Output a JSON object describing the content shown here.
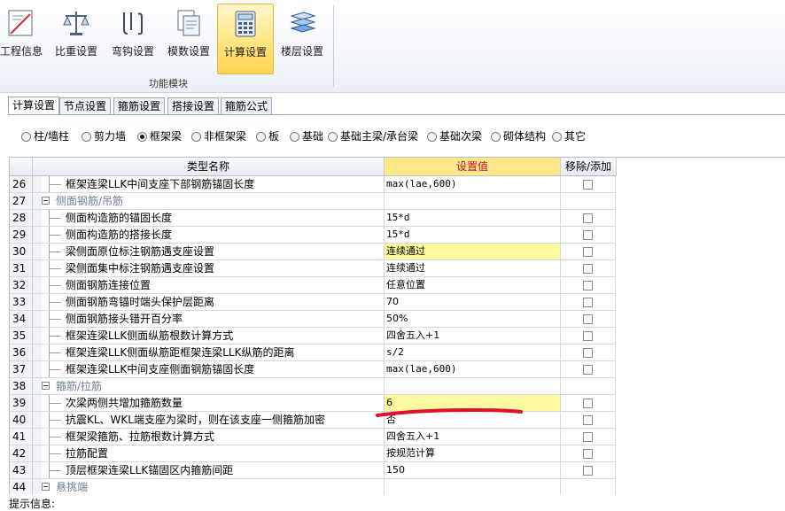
{
  "ribbon": {
    "buttons": [
      {
        "label": "工程信息",
        "icon": "project-info-icon"
      },
      {
        "label": "比重设置",
        "icon": "scale-icon"
      },
      {
        "label": "弯钩设置",
        "icon": "hook-icon"
      },
      {
        "label": "模数设置",
        "icon": "modulus-icon"
      },
      {
        "label": "计算设置",
        "icon": "calculator-icon",
        "active": true
      },
      {
        "label": "楼层设置",
        "icon": "floor-stack-icon"
      }
    ],
    "group_label": "功能模块"
  },
  "tabs": [
    "计算设置",
    "节点设置",
    "箍筋设置",
    "搭接设置",
    "箍筋公式"
  ],
  "radios": [
    {
      "label": "柱/墙柱",
      "checked": false
    },
    {
      "label": "剪力墙",
      "checked": false
    },
    {
      "label": "框架梁",
      "checked": true
    },
    {
      "label": "非框架梁",
      "checked": false
    },
    {
      "label": "板",
      "checked": false
    },
    {
      "label": "基础",
      "checked": false
    },
    {
      "label": "基础主梁/承台梁",
      "checked": false
    },
    {
      "label": "基础次梁",
      "checked": false
    },
    {
      "label": "砌体结构",
      "checked": false
    },
    {
      "label": "其它",
      "checked": false
    }
  ],
  "grid": {
    "headers": {
      "name": "类型名称",
      "value": "设置值",
      "action": "移除/添加"
    },
    "rows": [
      {
        "num": "26",
        "name": "框架连梁LLK中间支座下部钢筋锚固长度",
        "value": "max(lae,600)",
        "type": "item"
      },
      {
        "num": "27",
        "name": "侧面钢筋/吊筋",
        "value": "",
        "type": "group"
      },
      {
        "num": "28",
        "name": "侧面构造筋的锚固长度",
        "value": "15*d",
        "type": "item"
      },
      {
        "num": "29",
        "name": "侧面构造筋的搭接长度",
        "value": "15*d",
        "type": "item"
      },
      {
        "num": "30",
        "name": "梁侧面原位标注钢筋遇支座设置",
        "value": "连续通过",
        "type": "item",
        "highlight": true
      },
      {
        "num": "31",
        "name": "梁侧面集中标注钢筋遇支座设置",
        "value": "连续通过",
        "type": "item"
      },
      {
        "num": "32",
        "name": "侧面钢筋连接位置",
        "value": "任意位置",
        "type": "item"
      },
      {
        "num": "33",
        "name": "侧面钢筋弯锚时端头保护层距离",
        "value": "70",
        "type": "item"
      },
      {
        "num": "34",
        "name": "侧面钢筋接头错开百分率",
        "value": "50%",
        "type": "item"
      },
      {
        "num": "35",
        "name": "框架连梁LLK侧面纵筋根数计算方式",
        "value": "四舍五入+1",
        "type": "item"
      },
      {
        "num": "36",
        "name": "框架连梁LLK侧面纵筋距框架连梁LLK纵筋的距离",
        "value": "s/2",
        "type": "item"
      },
      {
        "num": "37",
        "name": "框架连梁LLK中间支座侧面钢筋锚固长度",
        "value": "max(lae,600)",
        "type": "item"
      },
      {
        "num": "38",
        "name": "箍筋/拉筋",
        "value": "",
        "type": "group"
      },
      {
        "num": "39",
        "name": "次梁两侧共增加箍筋数量",
        "value": "6",
        "type": "item",
        "highlight": true
      },
      {
        "num": "40",
        "name": "抗震KL、WKL端支座为梁时，则在该支座一侧箍筋加密",
        "value": "否",
        "type": "item"
      },
      {
        "num": "41",
        "name": "框架梁箍筋、拉筋根数计算方式",
        "value": "四舍五入+1",
        "type": "item"
      },
      {
        "num": "42",
        "name": "拉筋配置",
        "value": "按规范计算",
        "type": "item"
      },
      {
        "num": "43",
        "name": "顶层框架连梁LLK锚固区内箍筋间距",
        "value": "150",
        "type": "item"
      },
      {
        "num": "44",
        "name": "悬挑端",
        "value": "",
        "type": "group"
      }
    ]
  },
  "hint_label": "提示信息:",
  "colors": {
    "header_value_bg": "#ffe88a",
    "header_value_text": "#c4102a",
    "highlight_cell": "#fffaa0",
    "annotation": "#e0102a"
  }
}
